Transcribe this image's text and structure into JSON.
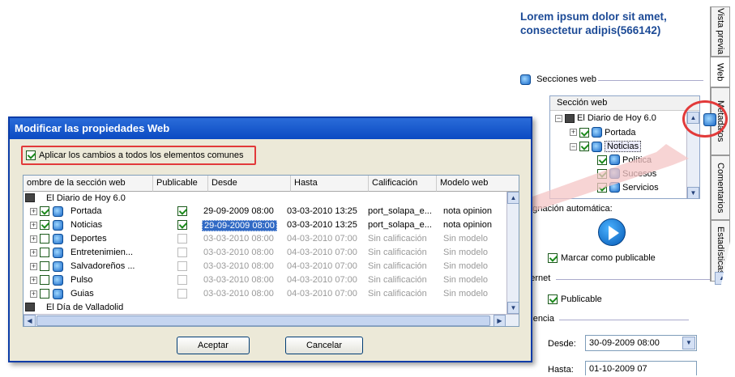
{
  "right_panel": {
    "title": "Lorem ipsum dolor sit amet, consectetur adipis(566142)",
    "tabs": [
      "Vista previa",
      "Web",
      "Metadatos",
      "Comentarios",
      "Estadísticas"
    ],
    "sections_label": "Secciones web",
    "tree_header": "Sección web",
    "tree_items": [
      {
        "label": "El Diario de Hoy 6.0"
      },
      {
        "label": "Portada"
      },
      {
        "label": "Noticias"
      },
      {
        "label": "Política"
      },
      {
        "label": "Sucesos"
      },
      {
        "label": "Servicios"
      }
    ],
    "auto_assign_label": "Asignación automática:",
    "mark_publishable_label": "Marcar como publicable",
    "internet_label": "Internet",
    "publishable_label": "Publicable",
    "validity_label": "Vigencia",
    "from_label": "Desde:",
    "from_value": "30-09-2009 08:00",
    "to_label": "Hasta:",
    "to_value": "01-10-2009 07"
  },
  "dialog": {
    "title": "Modificar las propiedades Web",
    "apply_all_label": "Aplicar los cambios a todos los elementos comunes",
    "columns": [
      "ombre de la sección web",
      "Publicable",
      "Desde",
      "Hasta",
      "Calificación",
      "Modelo web"
    ],
    "rows": [
      {
        "name": "El Diario de Hoy 6.0"
      },
      {
        "name": "Portada",
        "desde": "29-09-2009 08:00",
        "hasta": "03-03-2010 13:25",
        "calif": "port_solapa_e...",
        "modelo": "nota opinion"
      },
      {
        "name": "Noticias",
        "desde": "29-09-2009 08:00",
        "hasta": "03-03-2010 13:25",
        "calif": "port_solapa_e...",
        "modelo": "nota opinion"
      },
      {
        "name": "Deportes",
        "desde": "03-03-2010 08:00",
        "hasta": "04-03-2010 07:00",
        "calif": "Sin calificación",
        "modelo": "Sin modelo"
      },
      {
        "name": "Entretenimien...",
        "desde": "03-03-2010 08:00",
        "hasta": "04-03-2010 07:00",
        "calif": "Sin calificación",
        "modelo": "Sin modelo"
      },
      {
        "name": "Salvadoreños ...",
        "desde": "03-03-2010 08:00",
        "hasta": "04-03-2010 07:00",
        "calif": "Sin calificación",
        "modelo": "Sin modelo"
      },
      {
        "name": "Pulso",
        "desde": "03-03-2010 08:00",
        "hasta": "04-03-2010 07:00",
        "calif": "Sin calificación",
        "modelo": "Sin modelo"
      },
      {
        "name": "Guias",
        "desde": "03-03-2010 08:00",
        "hasta": "04-03-2010 07:00",
        "calif": "Sin calificación",
        "modelo": "Sin modelo"
      },
      {
        "name": "El Día de Valladolid"
      }
    ],
    "accept_label": "Aceptar",
    "cancel_label": "Cancelar"
  },
  "colors": {
    "title_blue": "#1c4a96",
    "highlight_red": "#e23a3a",
    "selection": "#316ac5",
    "arrow": "#f4c6c6"
  }
}
